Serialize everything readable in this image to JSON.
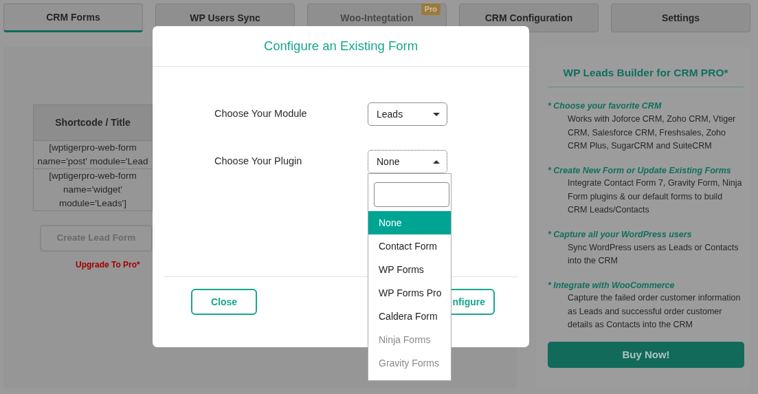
{
  "tabs": [
    {
      "label": "CRM Forms",
      "selected": true
    },
    {
      "label": "WP Users Sync",
      "selected": false
    },
    {
      "label": "Woo-Integtation",
      "selected": false,
      "disabled": true,
      "badge": "Pro"
    },
    {
      "label": "CRM Configuration",
      "selected": false
    },
    {
      "label": "Settings",
      "selected": false
    }
  ],
  "forms_panel": {
    "table": {
      "columns": [
        "Shortcode / Title"
      ],
      "rows": [
        [
          "[wptigerpro-web-form name='post' module='Lead"
        ],
        [
          "[wptigerpro-web-form name='widget' module='Leads']"
        ]
      ]
    },
    "create_button": {
      "label": "Create Lead Form",
      "disabled": true
    },
    "upgrade_link": "Upgrade To Pro*"
  },
  "promo": {
    "title": "WP Leads Builder for CRM PRO*",
    "features": [
      {
        "heading": "* Choose your favorite CRM",
        "text": "Works with Joforce CRM, Zoho CRM, Vtiger CRM, Salesforce CRM, Freshsales, Zoho CRM Plus, SugarCRM and SuiteCRM"
      },
      {
        "heading": "* Create New Form or Update Existing Forms",
        "text": "Integrate Contact Form 7, Gravity Form, Ninja Form plugins & our default forms to build CRM Leads/Contacts"
      },
      {
        "heading": "* Capture all your WordPress users",
        "text": "Sync WordPress users as Leads or Contacts into the CRM"
      },
      {
        "heading": "* Integrate with WooCommerce",
        "text": "Capture the failed order customer information as Leads and successful order customer details as Contacts into the CRM"
      }
    ],
    "buy_button": "Buy Now!"
  },
  "modal": {
    "title": "Configure an Existing Form",
    "fields": [
      {
        "label": "Choose Your Module",
        "value": "Leads",
        "expanded": false
      },
      {
        "label": "Choose Your Plugin",
        "value": "None",
        "expanded": true
      }
    ],
    "dropdown": {
      "options": [
        {
          "label": "None",
          "selected": true,
          "disabled": false
        },
        {
          "label": "Contact Form",
          "selected": false,
          "disabled": false
        },
        {
          "label": "WP Forms",
          "selected": false,
          "disabled": false
        },
        {
          "label": "WP Forms Pro",
          "selected": false,
          "disabled": false
        },
        {
          "label": "Caldera Form",
          "selected": false,
          "disabled": false
        },
        {
          "label": "Ninja Forms",
          "selected": false,
          "disabled": true
        },
        {
          "label": "Gravity Forms",
          "selected": false,
          "disabled": true
        }
      ]
    },
    "buttons": [
      {
        "label": "Close",
        "kind": "close"
      },
      {
        "label": "nfigure",
        "kind": "submit"
      }
    ]
  }
}
